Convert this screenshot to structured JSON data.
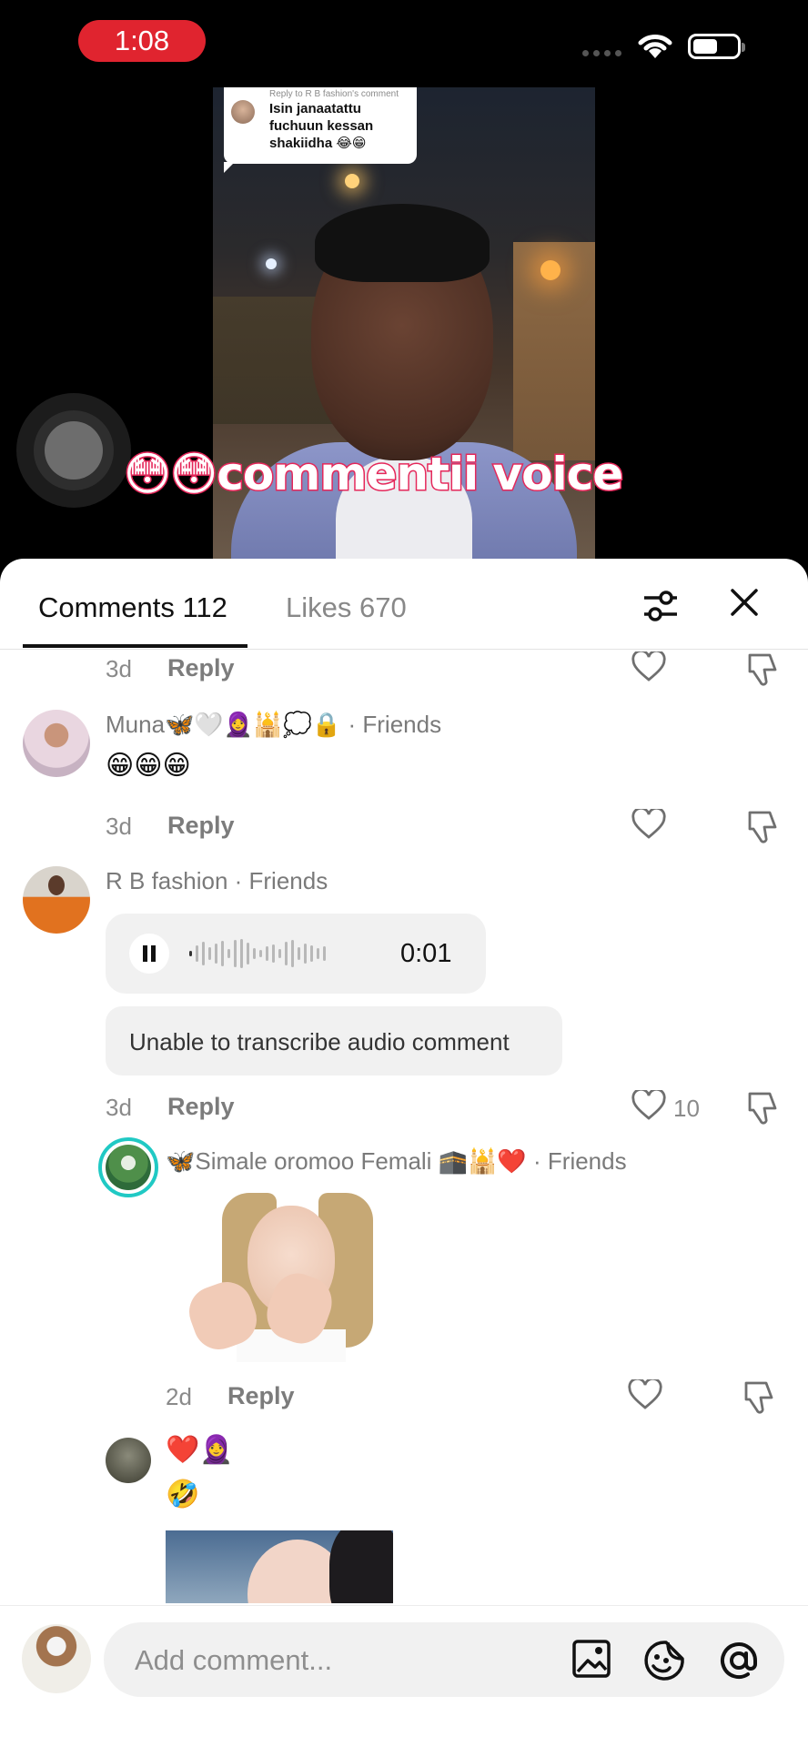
{
  "status": {
    "time": "1:08"
  },
  "video": {
    "reply_to": "Reply to R B fashion's comment",
    "reply_text": "Isin janaatattu fuchuun kessan shakiidha 😂😁",
    "overlay": "😳😳commentii voice"
  },
  "tabs": {
    "comments": "Comments 112",
    "likes": "Likes 670"
  },
  "comments": [
    {
      "time": "3d",
      "reply": "Reply"
    },
    {
      "user": "Muna🦋🤍🧕🕌💭🔒 · Friends",
      "text": "😁😁😁",
      "time": "3d",
      "reply": "Reply"
    },
    {
      "user": "R B fashion · Friends",
      "voice_duration": "0:01",
      "transcribe": "Unable to transcribe audio comment",
      "time": "3d",
      "reply": "Reply",
      "likes": "10"
    },
    {
      "user": "🦋Simale oromoo Femali 🕋🕌❤️ · Friends",
      "time": "2d",
      "reply": "Reply"
    },
    {
      "text1": "❤️🧕",
      "text2": "🤣"
    }
  ],
  "input": {
    "placeholder": "Add comment..."
  }
}
